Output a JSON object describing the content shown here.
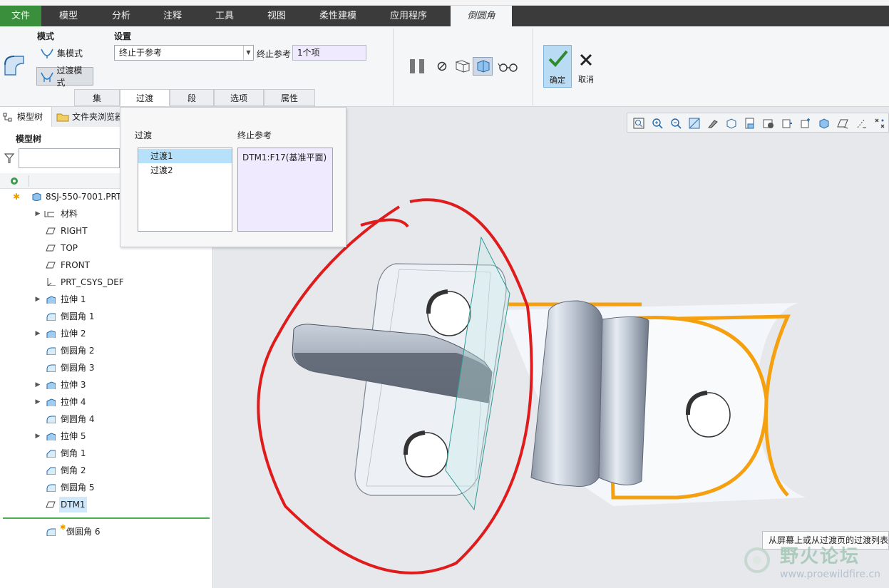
{
  "menubar": {
    "items": [
      {
        "label": "文件"
      },
      {
        "label": "模型"
      },
      {
        "label": "分析"
      },
      {
        "label": "注释"
      },
      {
        "label": "工具"
      },
      {
        "label": "视图"
      },
      {
        "label": "柔性建模"
      },
      {
        "label": "应用程序"
      },
      {
        "label": "倒圆角"
      }
    ]
  },
  "ribbon": {
    "mode_heading": "模式",
    "settings_heading": "设置",
    "set_mode_label": "集模式",
    "transition_mode_label": "过渡模式",
    "transition_type_value": "终止于参考",
    "end_ref_label": "终止参考",
    "end_ref_value": "1个项",
    "ok_label": "确定",
    "cancel_label": "取消",
    "subtabs": [
      "集",
      "过渡",
      "段",
      "选项",
      "属性"
    ]
  },
  "leftpane": {
    "tab_model_tree": "模型树",
    "tab_folder_browser": "文件夹浏览器",
    "heading": "模型树",
    "root": "8SJ-550-7001.PRT",
    "items": [
      {
        "label": "材料"
      },
      {
        "label": "RIGHT"
      },
      {
        "label": "TOP"
      },
      {
        "label": "FRONT"
      },
      {
        "label": "PRT_CSYS_DEF"
      },
      {
        "label": "拉伸 1"
      },
      {
        "label": "倒圆角 1"
      },
      {
        "label": "拉伸 2"
      },
      {
        "label": "倒圆角 2"
      },
      {
        "label": "倒圆角 3"
      },
      {
        "label": "拉伸 3"
      },
      {
        "label": "拉伸 4"
      },
      {
        "label": "倒圆角 4"
      },
      {
        "label": "拉伸 5"
      },
      {
        "label": "倒角 1"
      },
      {
        "label": "倒角 2"
      },
      {
        "label": "倒圆角 5"
      },
      {
        "label": "DTM1"
      }
    ],
    "insert_item": "倒圆角 6"
  },
  "flyout": {
    "transitions_heading": "过渡",
    "end_ref_heading": "终止参考",
    "transitions": [
      "过渡1",
      "过渡2"
    ],
    "end_ref_value": "DTM1:F17(基准平面)"
  },
  "status": {
    "tooltip": "从屏幕上或从过渡页的过渡列表"
  },
  "watermark": {
    "title": "野火论坛",
    "url": "www.proewildfire.cn"
  },
  "colors": {
    "accent": "#3a8f3d",
    "menubar": "#3b3b3b",
    "highlight_edge": "#f5a10f",
    "annotation": "#e01b1b"
  }
}
